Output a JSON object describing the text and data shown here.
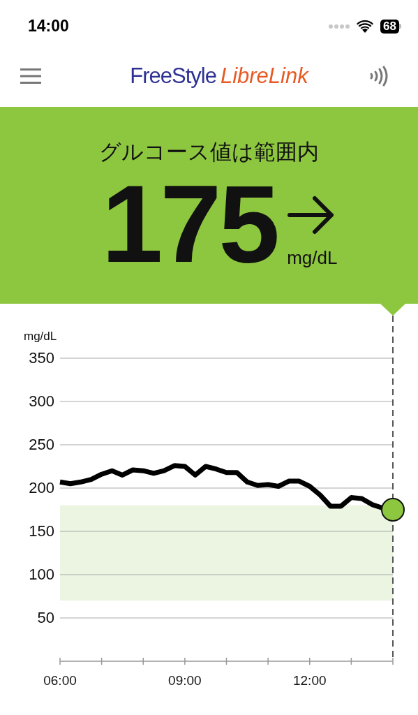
{
  "status_bar": {
    "time": "14:00",
    "battery": "68"
  },
  "nav_bar": {
    "logo_first": "FreeStyle",
    "logo_second": "LibreLink"
  },
  "reading": {
    "title": "グルコース値は範囲内",
    "value": "175",
    "unit": "mg/dL"
  },
  "chart": {
    "unit_label": "mg/dL",
    "chart_data": {
      "type": "line",
      "xlim": [
        6,
        14
      ],
      "ylim": [
        0,
        350
      ],
      "yticks": [
        50,
        100,
        150,
        200,
        250,
        300,
        350
      ],
      "xticks": [
        {
          "value": 6,
          "label": "06:00"
        },
        {
          "value": 9,
          "label": "09:00"
        },
        {
          "value": 12,
          "label": "12:00"
        }
      ],
      "grid": true,
      "bands": [
        {
          "axis": "y",
          "from": 70,
          "to": 180
        }
      ],
      "x": [
        6,
        6.25,
        6.5,
        6.75,
        7,
        7.25,
        7.5,
        7.75,
        8,
        8.25,
        8.5,
        8.75,
        9,
        9.25,
        9.5,
        9.75,
        10,
        10.25,
        10.5,
        10.75,
        11,
        11.25,
        11.5,
        11.75,
        12,
        12.25,
        12.5,
        12.75,
        13,
        13.25,
        13.5,
        13.75
      ],
      "series": [
        {
          "color": "#000000",
          "values": [
            207,
            205,
            207,
            210,
            216,
            220,
            215,
            221,
            220,
            217,
            220,
            226,
            225,
            215,
            225,
            222,
            218,
            218,
            207,
            203,
            204,
            202,
            208,
            208,
            202,
            192,
            179,
            179,
            189,
            188,
            181,
            177
          ]
        }
      ]
    }
  }
}
